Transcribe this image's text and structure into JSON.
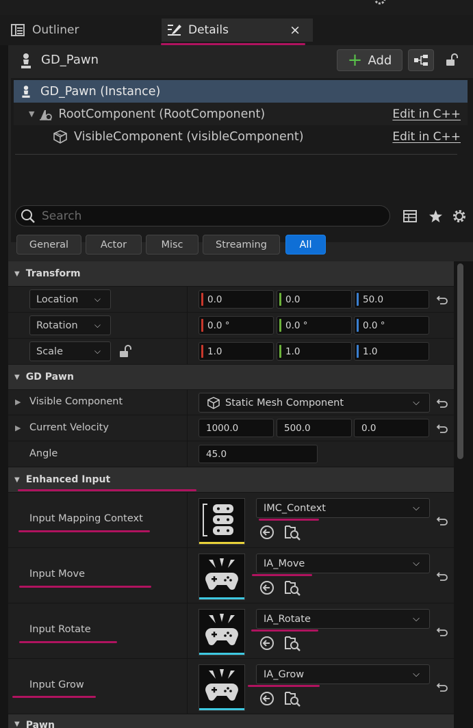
{
  "tabs": [
    {
      "label": "Outliner",
      "icon": "outliner-icon"
    },
    {
      "label": "Details",
      "icon": "details-icon",
      "close": "×"
    }
  ],
  "header": {
    "actor_name": "GD_Pawn",
    "add_label": "Add"
  },
  "components": [
    {
      "label": "GD_Pawn (Instance)",
      "selected": true
    },
    {
      "label": "RootComponent (RootComponent)",
      "link": "Edit in C++"
    },
    {
      "label": "VisibleComponent (visibleComponent)",
      "link": "Edit in C++"
    }
  ],
  "search": {
    "placeholder": "Search"
  },
  "filters": [
    "General",
    "Actor",
    "Misc",
    "Streaming",
    "All"
  ],
  "active_filter": "All",
  "sections": {
    "transform": "Transform",
    "gd_pawn": "GD Pawn",
    "enhanced_input": "Enhanced Input",
    "pawn": "Pawn"
  },
  "transform": {
    "location": {
      "label": "Location",
      "x": "0.0",
      "y": "0.0",
      "z": "50.0"
    },
    "rotation": {
      "label": "Rotation",
      "x": "0.0 °",
      "y": "0.0 °",
      "z": "0.0 °"
    },
    "scale": {
      "label": "Scale",
      "x": "1.0",
      "y": "1.0",
      "z": "1.0"
    }
  },
  "gd_pawn": {
    "visible_component": {
      "label": "Visible Component",
      "value": "Static Mesh Component"
    },
    "current_velocity": {
      "label": "Current Velocity",
      "x": "1000.0",
      "y": "500.0",
      "z": "0.0"
    },
    "angle": {
      "label": "Angle",
      "value": "45.0"
    }
  },
  "enhanced_input": [
    {
      "label": "Input Mapping Context",
      "value": "IMC_Context",
      "accent": "#e8d23a",
      "icon": "input-mapping-context-icon"
    },
    {
      "label": "Input Move",
      "value": "IA_Move",
      "accent": "#3ec8e0",
      "icon": "input-action-icon"
    },
    {
      "label": "Input Rotate",
      "value": "IA_Rotate",
      "accent": "#3ec8e0",
      "icon": "input-action-icon"
    },
    {
      "label": "Input Grow",
      "value": "IA_Grow",
      "accent": "#3ec8e0",
      "icon": "input-action-icon"
    }
  ],
  "colors": {
    "x_axis": "#c8382c",
    "y_axis": "#6bb13a",
    "z_axis": "#3a7fd0",
    "accent": "#0f6fd6",
    "highlight": "#b0135f"
  }
}
